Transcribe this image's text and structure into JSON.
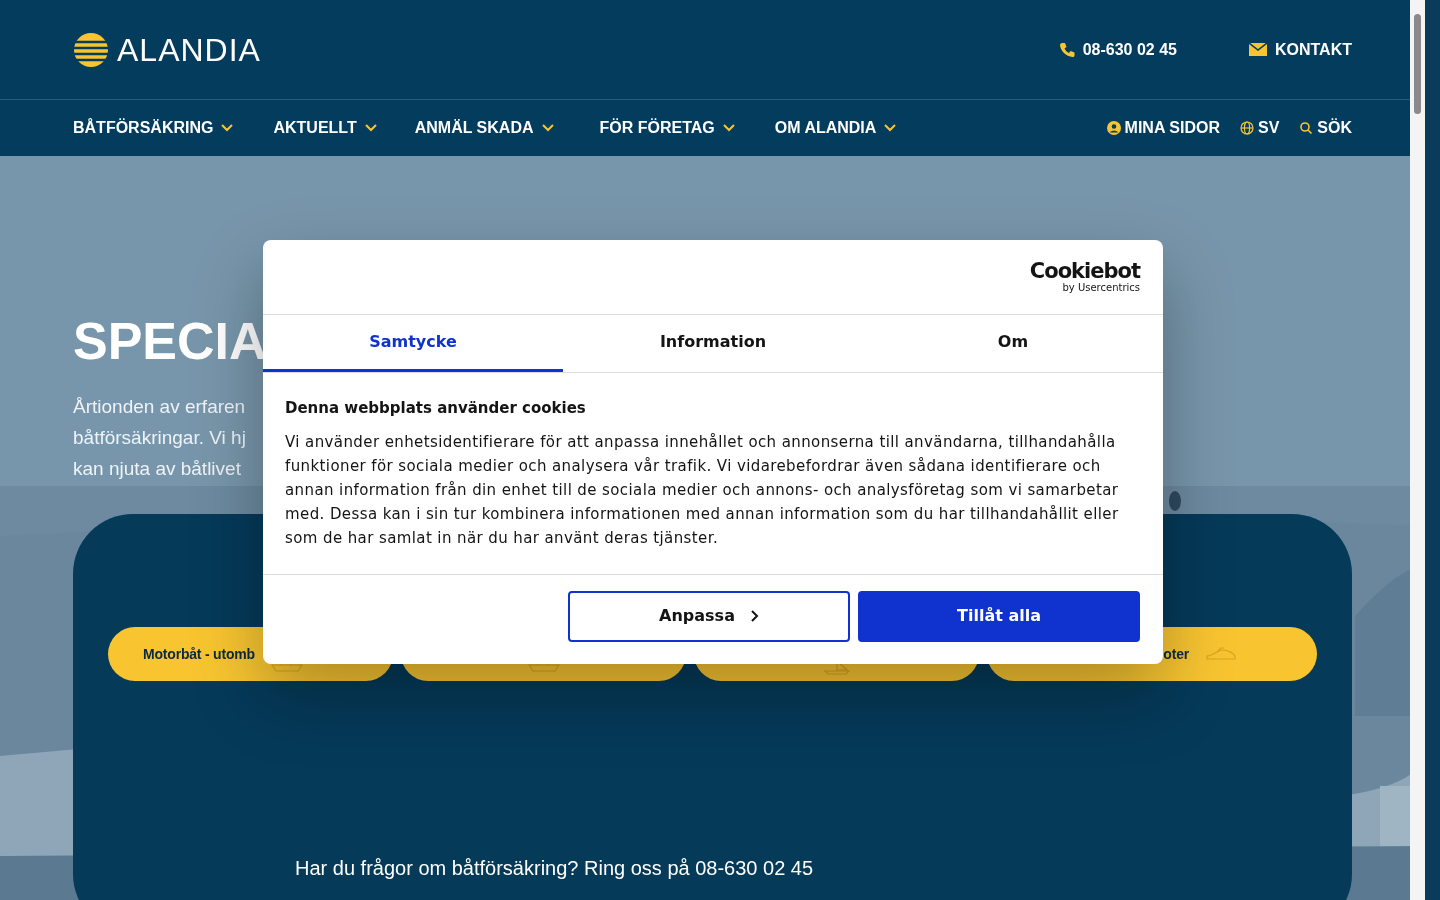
{
  "header": {
    "logo": "ALANDIA",
    "phone": "08-630 02 45",
    "contact": "KONTAKT"
  },
  "nav": {
    "items": [
      {
        "label": "BÅTFÖRSÄKRING"
      },
      {
        "label": "AKTUELLT"
      },
      {
        "label": "ANMÄL SKADA"
      },
      {
        "label": "FÖR FÖRETAG"
      },
      {
        "label": "OM ALANDIA"
      }
    ],
    "utilities": [
      {
        "kind": "account",
        "label": "MINA SIDOR"
      },
      {
        "kind": "language",
        "label": "SV"
      },
      {
        "kind": "search",
        "label": "SÖK"
      }
    ]
  },
  "hero": {
    "title": "SPECIA",
    "lines": [
      "Årtionden av erfaren",
      "båtförsäkringar. Vi hj",
      "kan njuta av båtlivet"
    ]
  },
  "categories": [
    {
      "kind": "boat",
      "label": "Motorbåt - utomb"
    },
    {
      "kind": "boat"
    },
    {
      "kind": "sail"
    },
    {
      "kind": "jetski",
      "label": "oter"
    }
  ],
  "contact_note": "Har du frågor om båtförsäkring? Ring oss på 08-630 02 45",
  "cookie_dialog": {
    "brand": "Cookiebot",
    "brand_sub": "by Usercentrics",
    "tabs": [
      {
        "label": "Samtycke",
        "selected": true
      },
      {
        "label": "Information",
        "selected": false
      },
      {
        "label": "Om",
        "selected": false
      }
    ],
    "heading": "Denna webbplats använder cookies",
    "body": "Vi använder enhetsidentifierare för att anpassa innehållet och annonserna till användarna, tillhandahålla funktioner för sociala medier och analysera vår trafik. Vi vidarebefordrar även sådana identifierare och annan information från din enhet till de sociala medier och annons- och analysföretag som vi samarbetar med. Dessa kan i sin tur kombinera informationen med annan information som du har tillhandahållit eller som de har samlat in när du har använt deras tjänster.",
    "buttons": [
      {
        "kind": "outline",
        "label": "Anpassa"
      },
      {
        "kind": "primary",
        "label": "Tillåt alla"
      }
    ]
  }
}
